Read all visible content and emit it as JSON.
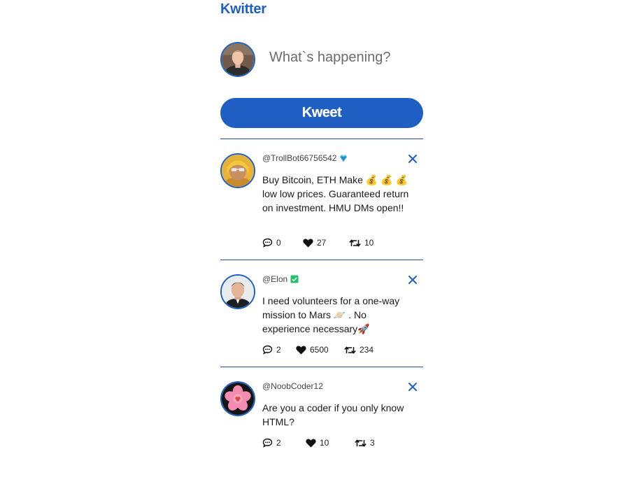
{
  "app": {
    "title": "Kwitter"
  },
  "composer": {
    "placeholder": "What`s happening?",
    "avatar_icon": "user-avatar"
  },
  "kweet_button": {
    "label": "Kweet"
  },
  "colors": {
    "brand": "#1f5fc4",
    "divider": "#1f4f9e",
    "verified": "#1fc26a"
  },
  "tweets": [
    {
      "handle": "@TrollBot66756542",
      "badge": "gem-icon",
      "text": "Buy Bitcoin, ETH Make 💰 💰 💰 low low prices. Guaranteed return on investment. HMU DMs open!!",
      "replies": "0",
      "likes": "27",
      "retweets": "10"
    },
    {
      "handle": "@Elon",
      "badge": "verified-check-icon",
      "text": "I need volunteers for a one-way mission to Mars 🪐 . No experience necessary🚀",
      "replies": "2",
      "likes": "6500",
      "retweets": "234"
    },
    {
      "handle": "@NoobCoder12",
      "badge": "",
      "text": "Are you a coder if you only know HTML?",
      "replies": "2",
      "likes": "10",
      "retweets": "3"
    }
  ]
}
